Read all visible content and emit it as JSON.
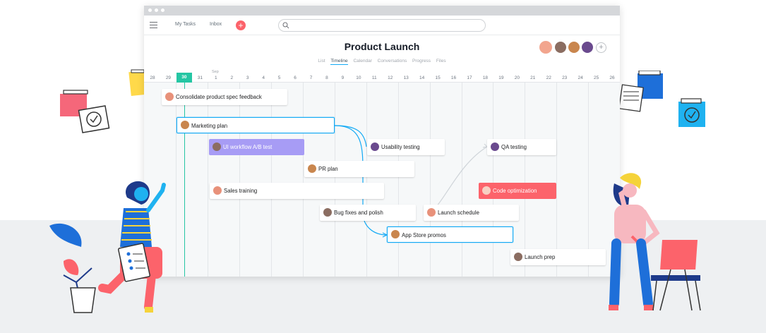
{
  "topbar": {
    "my_tasks": "My Tasks",
    "inbox": "Inbox",
    "add_symbol": "+",
    "search_placeholder": ""
  },
  "project": {
    "title": "Product Launch",
    "add_member_symbol": "+"
  },
  "tabs": [
    {
      "label": "List",
      "active": false
    },
    {
      "label": "Timeline",
      "active": true
    },
    {
      "label": "Calendar",
      "active": false
    },
    {
      "label": "Conversations",
      "active": false
    },
    {
      "label": "Progress",
      "active": false
    },
    {
      "label": "Files",
      "active": false
    }
  ],
  "timeline": {
    "month_label": "Sep",
    "dates": [
      "28",
      "29",
      "30",
      "31",
      "1",
      "2",
      "3",
      "4",
      "5",
      "6",
      "7",
      "8",
      "9",
      "10",
      "11",
      "12",
      "13",
      "14",
      "15",
      "16",
      "17",
      "18",
      "19",
      "20",
      "21",
      "22",
      "23",
      "24",
      "25",
      "26"
    ],
    "today": "30"
  },
  "tasks": [
    {
      "name": "Consolidate product spec feedback",
      "style": "normal"
    },
    {
      "name": "Marketing plan",
      "style": "selected"
    },
    {
      "name": "UI workflow A/B test",
      "style": "purple"
    },
    {
      "name": "Usability testing",
      "style": "normal"
    },
    {
      "name": "QA testing",
      "style": "normal"
    },
    {
      "name": "PR plan",
      "style": "normal"
    },
    {
      "name": "Sales training",
      "style": "normal"
    },
    {
      "name": "Code optimization",
      "style": "red"
    },
    {
      "name": "Bug fixes and polish",
      "style": "normal"
    },
    {
      "name": "Launch schedule",
      "style": "normal"
    },
    {
      "name": "App Store promos",
      "style": "selected"
    },
    {
      "name": "Launch prep",
      "style": "normal"
    }
  ],
  "colors": {
    "accent_blue": "#14aaf5",
    "today_green": "#25c6a4",
    "brand_coral": "#fc636b",
    "task_purple": "#a79cf5"
  }
}
